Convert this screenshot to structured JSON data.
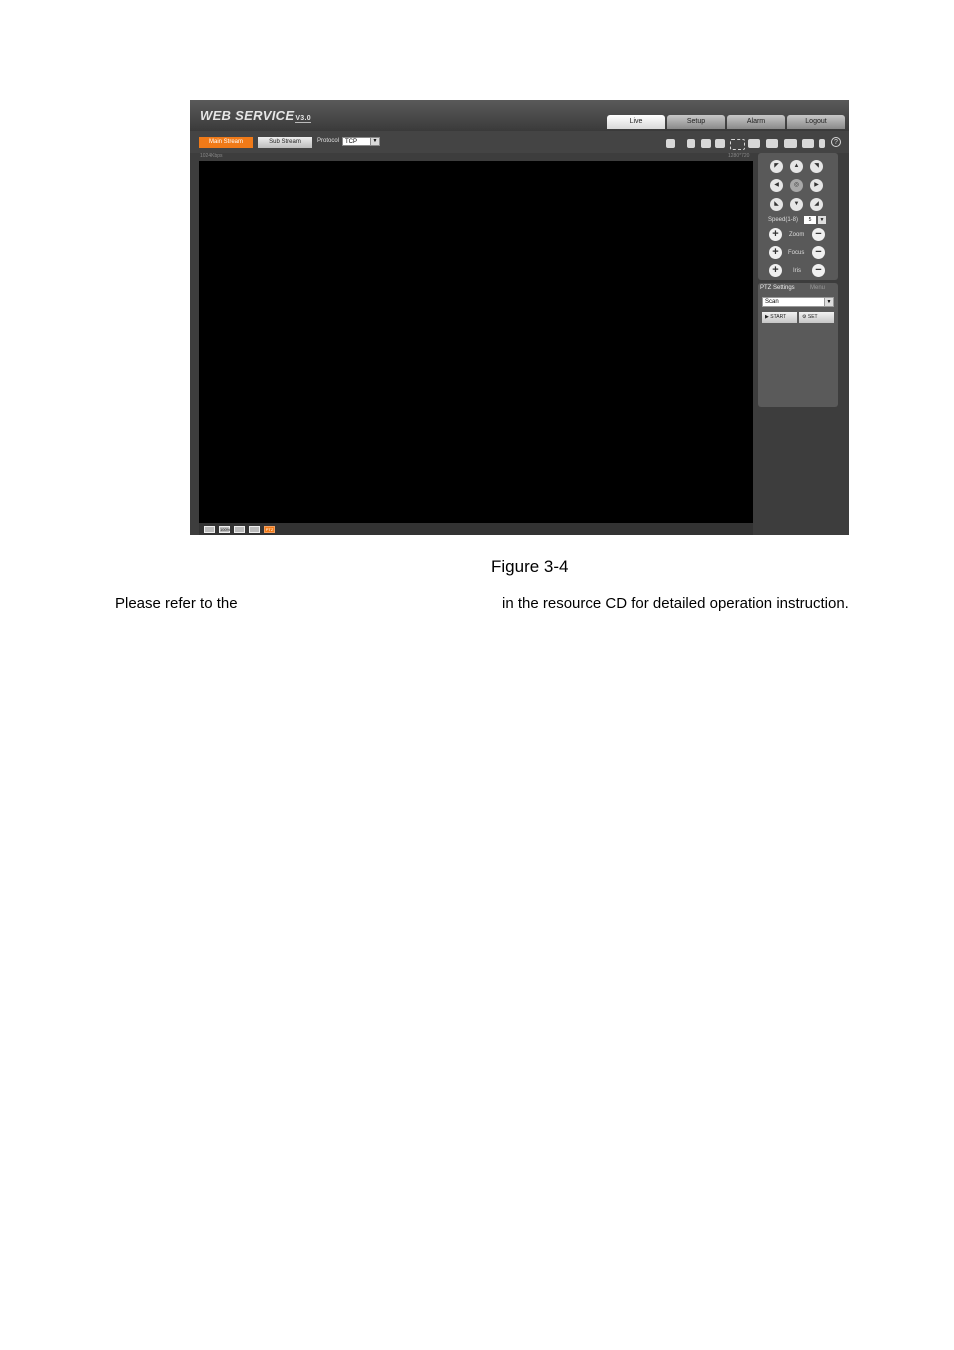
{
  "app": {
    "logo_text": "WEB  SERVICE",
    "logo_version": "V3.0",
    "tabs": [
      "Live",
      "Setup",
      "Alarm",
      "Logout"
    ],
    "active_tab": "Live"
  },
  "toolbar": {
    "main_stream": "Main Stream",
    "sub_stream": "Sub Stream",
    "protocol_label": "Protocol",
    "protocol_value": "TCP",
    "icons": [
      "draw-icon",
      "hand-icon",
      "alarm-icon",
      "alarm-icon",
      "zoom-region-icon",
      "snapshot-icon",
      "record-icon",
      "camera-icon",
      "speaker-icon",
      "microphone-icon",
      "help-icon"
    ],
    "help_label": "?"
  },
  "video": {
    "resolution_left": "1024Kbps",
    "resolution_right": "1280*720",
    "bottom_icons": [
      "image-icon",
      "zoom-icon",
      "fullscreen-icon",
      "ratio-icon",
      "ptz-icon"
    ],
    "bottom_labels": [
      "",
      "100%",
      "",
      "",
      "PTZ"
    ]
  },
  "ptz": {
    "speed_label": "Speed(1-8)",
    "speed_value": "5",
    "zoom_label": "Zoom",
    "focus_label": "Focus",
    "iris_label": "Iris",
    "plus": "+",
    "minus": "−"
  },
  "ptz_settings": {
    "title": "PTZ Settings",
    "menu": "Menu",
    "select_value": "Scan",
    "start_label": "START",
    "set_label": "SET"
  },
  "doc": {
    "caption": "Figure 3-4",
    "para_start": "Please refer to the",
    "para_end": "in the resource CD for detailed operation instruction."
  }
}
